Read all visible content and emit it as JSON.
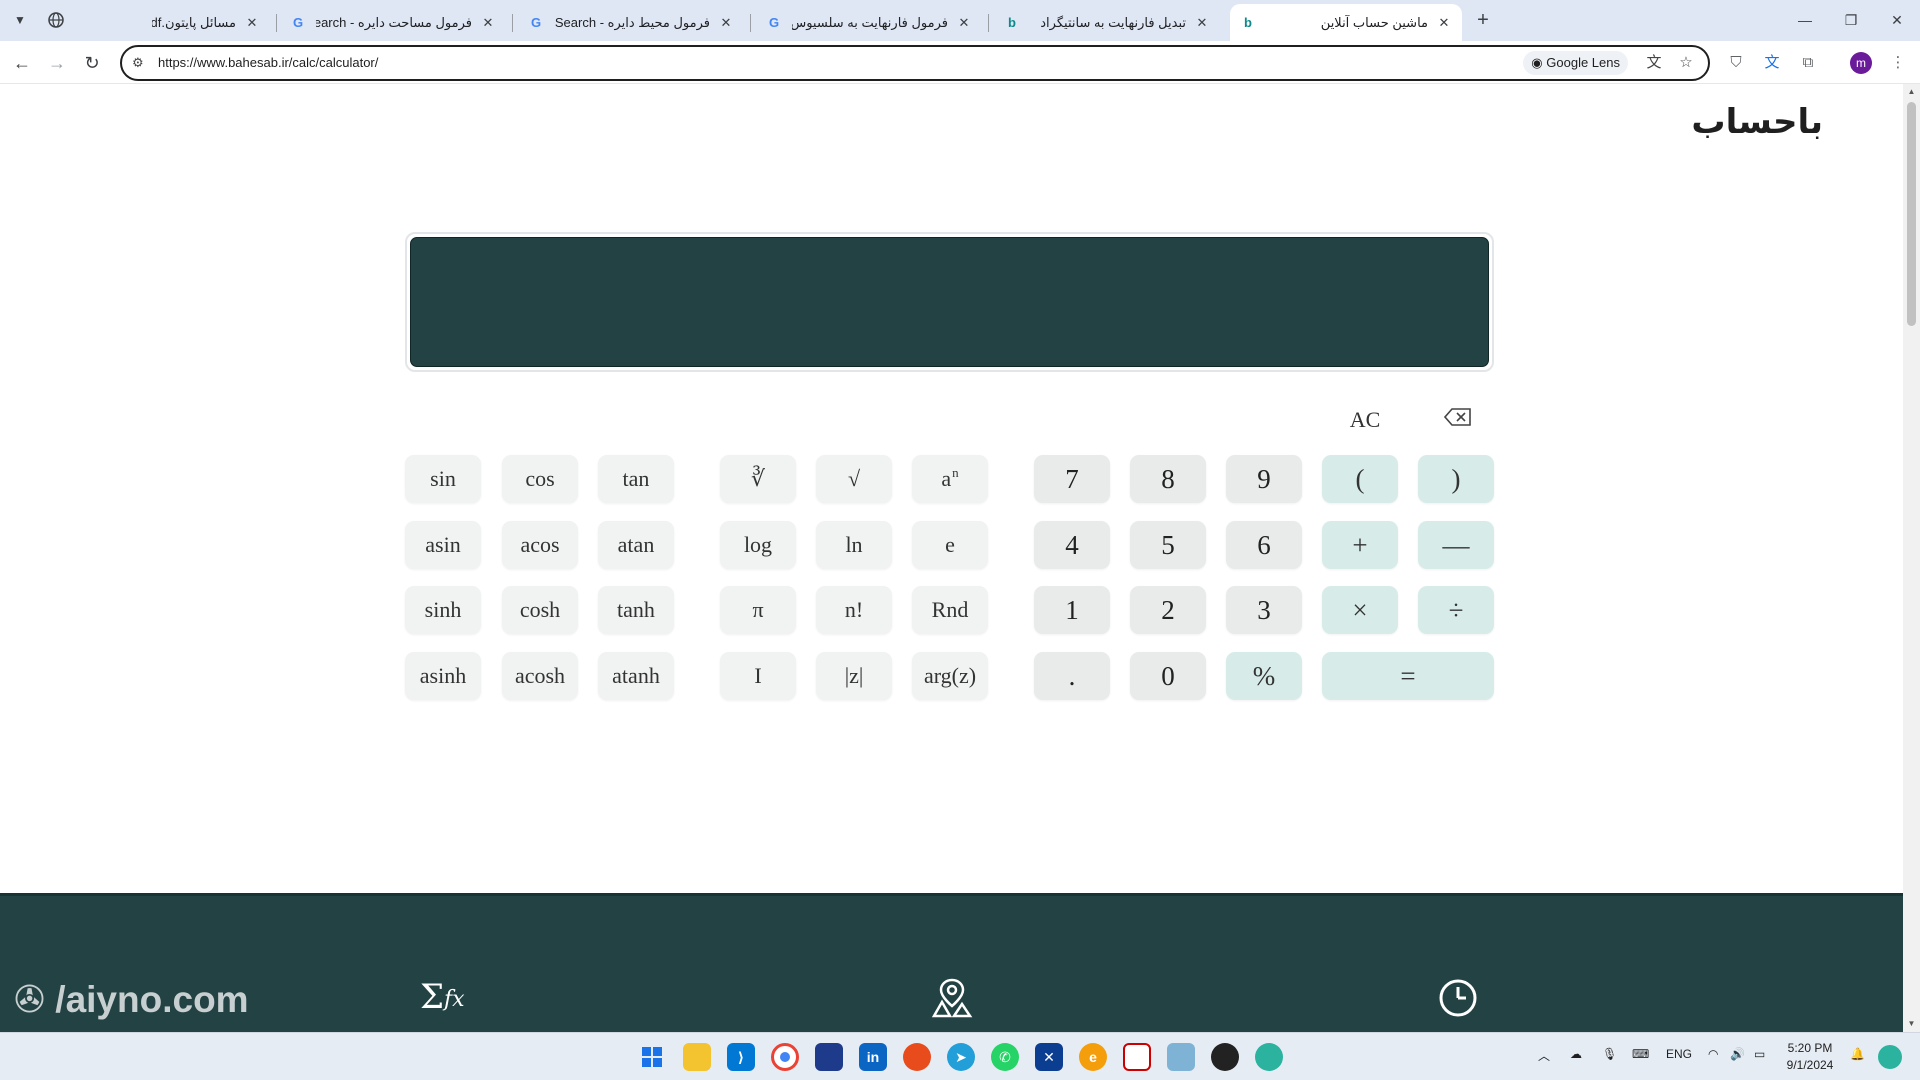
{
  "tabs": [
    {
      "title": "مسائل پایتون.pdf",
      "icon": "globe-icon"
    },
    {
      "title": "فرمول مساحت دایره - Google Search",
      "icon": "google-icon"
    },
    {
      "title": "فرمول محیط دایره - Google Search",
      "icon": "google-icon"
    },
    {
      "title": "فرمول فارنهایت به سلسیوس - Search",
      "icon": "google-icon"
    },
    {
      "title": "تبدیل فارنهایت به سانتیگراد",
      "icon": "bing-icon"
    },
    {
      "title": "ماشین حساب آنلاین",
      "icon": "bing-icon",
      "active": true
    }
  ],
  "toolbar": {
    "url": "https://www.bahesab.ir/calc/calculator/",
    "lens_label": "Google Lens",
    "avatar_letter": "m"
  },
  "page": {
    "brand": "باحساب",
    "controls": {
      "clear": "AC",
      "backspace_icon": "backspace-icon"
    },
    "keys": {
      "sin": "sin",
      "cos": "cos",
      "tan": "tan",
      "cbrt": "∛",
      "sqrt": "√",
      "pow_base": "a",
      "pow_exp": "n",
      "seven": "7",
      "eight": "8",
      "nine": "9",
      "lparen": "(",
      "rparen": ")",
      "asin": "asin",
      "acos": "acos",
      "atan": "atan",
      "log": "log",
      "ln": "ln",
      "e": "e",
      "four": "4",
      "five": "5",
      "six": "6",
      "plus": "+",
      "minus": "—",
      "sinh": "sinh",
      "cosh": "cosh",
      "tanh": "tanh",
      "pi": "π",
      "factorial": "n!",
      "rnd": "Rnd",
      "one": "1",
      "two": "2",
      "three": "3",
      "times": "×",
      "divide": "÷",
      "asinh": "asinh",
      "acosh": "acosh",
      "atanh": "atanh",
      "imag": "I",
      "abs": "|z|",
      "arg": "arg(z)",
      "dot": ".",
      "zero": "0",
      "percent": "%",
      "equals": "="
    },
    "footer": {
      "watermark": "/aiyno.com"
    }
  },
  "taskbar": {
    "lang": "ENG",
    "time": "5:20 PM",
    "date": "9/1/2024"
  },
  "colors": {
    "display_bg": "#234243",
    "operator_key": "#d7ece9",
    "number_key": "#e9eaea",
    "function_key": "#f1f2f2"
  }
}
